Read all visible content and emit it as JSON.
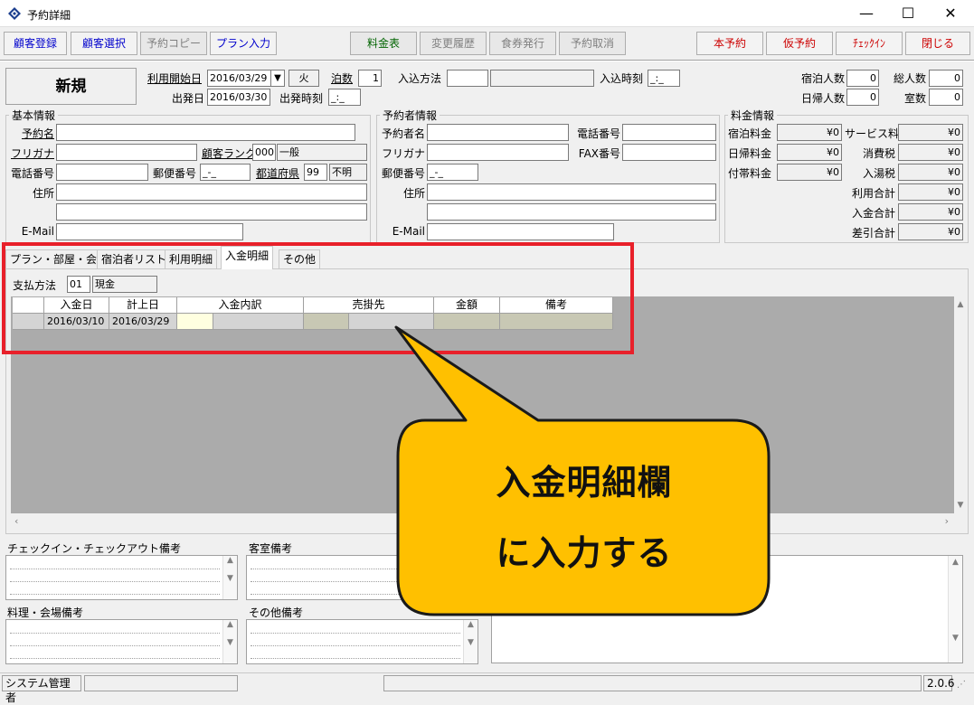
{
  "window": {
    "title": "予約詳細",
    "minimize": "—",
    "maximize": "☐",
    "close": "✕"
  },
  "toolbar": {
    "customer_register": "顧客登録",
    "customer_select": "顧客選択",
    "reservation_copy": "予約コピー",
    "plan_input": "プラン入力",
    "rate_table": "料金表",
    "change_history": "変更履歴",
    "meal_ticket": "食券発行",
    "cancel_reservation": "予約取消",
    "confirm_reservation": "本予約",
    "tentative_reservation": "仮予約",
    "checkin": "ﾁｪｯｸｲﾝ",
    "close_label": "閉じる"
  },
  "header": {
    "status": "新規",
    "start_date_label": "利用開始日",
    "start_date": "2016/03/29",
    "weekday": "火",
    "nights_label": "泊数",
    "nights": "1",
    "arrival_method_label": "入込方法",
    "arrival_method_code": "",
    "arrival_method_name": "",
    "arrival_time_label": "入込時刻",
    "arrival_time": "_:_",
    "departure_date_label": "出発日",
    "departure_date": "2016/03/30",
    "departure_time_label": "出発時刻",
    "departure_time": "_:_",
    "guests_label": "宿泊人数",
    "guests": "0",
    "total_label": "総人数",
    "total": "0",
    "day_guests_label": "日帰人数",
    "day_guests": "0",
    "rooms_label": "室数",
    "rooms": "0"
  },
  "basic": {
    "title": "基本情報",
    "name_label": "予約名",
    "name": "",
    "kana_label": "フリガナ",
    "kana": "",
    "rank_label": "顧客ランク",
    "rank_code": "000",
    "rank_name": "一般",
    "phone_label": "電話番号",
    "phone": "",
    "postal_label": "郵便番号",
    "postal": "_-_",
    "prefecture_label": "都道府県",
    "prefecture_code": "99",
    "prefecture_name": "不明",
    "address_label": "住所",
    "address1": "",
    "address2": "",
    "email_label": "E-Mail",
    "email": ""
  },
  "booker": {
    "title": "予約者情報",
    "name_label": "予約者名",
    "name": "",
    "phone_label": "電話番号",
    "phone": "",
    "kana_label": "フリガナ",
    "kana": "",
    "fax_label": "FAX番号",
    "fax": "",
    "postal_label": "郵便番号",
    "postal": "_-_",
    "address_label": "住所",
    "address1": "",
    "address2": "",
    "email_label": "E-Mail",
    "email": ""
  },
  "charges": {
    "title": "料金情報",
    "lodging_label": "宿泊料金",
    "lodging": "¥0",
    "service_label": "サービス料",
    "service": "¥0",
    "daytrip_label": "日帰料金",
    "daytrip": "¥0",
    "tax_label": "消費税",
    "tax": "¥0",
    "extra_label": "付帯料金",
    "extra": "¥0",
    "bath_tax_label": "入湯税",
    "bath_tax": "¥0",
    "usage_total_label": "利用合計",
    "usage_total": "¥0",
    "payment_total_label": "入金合計",
    "payment_total": "¥0",
    "balance_label": "差引合計",
    "balance": "¥0"
  },
  "tabs": {
    "plan": "プラン・部屋・会場",
    "guests": "宿泊者リスト",
    "usage": "利用明細",
    "payment": "入金明細",
    "other": "その他"
  },
  "payment": {
    "method_label": "支払方法",
    "method_code": "01",
    "method_name": "現金",
    "columns": {
      "date": "入金日",
      "post_date": "計上日",
      "detail": "入金内訳",
      "account": "売掛先",
      "amount": "金額",
      "note": "備考"
    },
    "row": {
      "date": "2016/03/10",
      "post_date": "2016/03/29"
    }
  },
  "memos": {
    "checkin": "チェックイン・チェックアウト備考",
    "room": "客室備考",
    "meal": "料理・会場備考",
    "other": "その他備考"
  },
  "status": {
    "user": "システム管理者",
    "version": "2.0.6"
  },
  "callout": {
    "line1": "入金明細欄",
    "line2": "に入力する"
  }
}
